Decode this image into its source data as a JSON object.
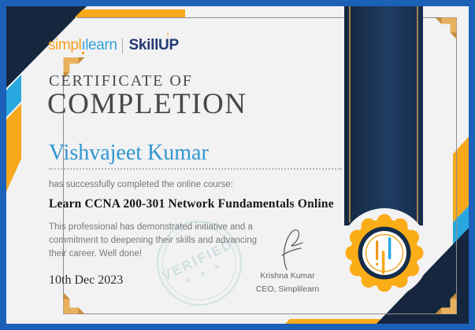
{
  "brand": {
    "left_1": "simpl",
    "left_i": "ı",
    "left_2": "learn",
    "right": "SkillUP"
  },
  "certificate": {
    "label": "CERTIFICATE OF",
    "title": "COMPLETION",
    "recipient": "Vishvajeet Kumar",
    "subtitle": "has successfully completed the online course:",
    "course": "Learn CCNA 200-301 Network Fundamentals Online",
    "description_lines": [
      "This professional has demonstrated initiative and a",
      "commitment to deepening their skills and advancing",
      "their career. Well done!"
    ],
    "date": "10th Dec 2023",
    "signer": {
      "name": "Krishna Kumar",
      "title": "CEO, Simplilearn"
    },
    "stamp": {
      "text": "VERIFIED",
      "stars": "★ ★ ★"
    }
  },
  "colors": {
    "border_blue": "#1c61b8",
    "paper": "#f2f2f3",
    "navy": "#16263e",
    "cyan": "#29a8e0",
    "yellow": "#f8a81b",
    "gold_bracket": "#e8b160",
    "brand_orange": "#f5a01f",
    "brand_blue": "#35a3dc",
    "brand_navy": "#223a73",
    "name_blue": "#2f96d1",
    "stamp_teal": "#cfe1e0"
  }
}
